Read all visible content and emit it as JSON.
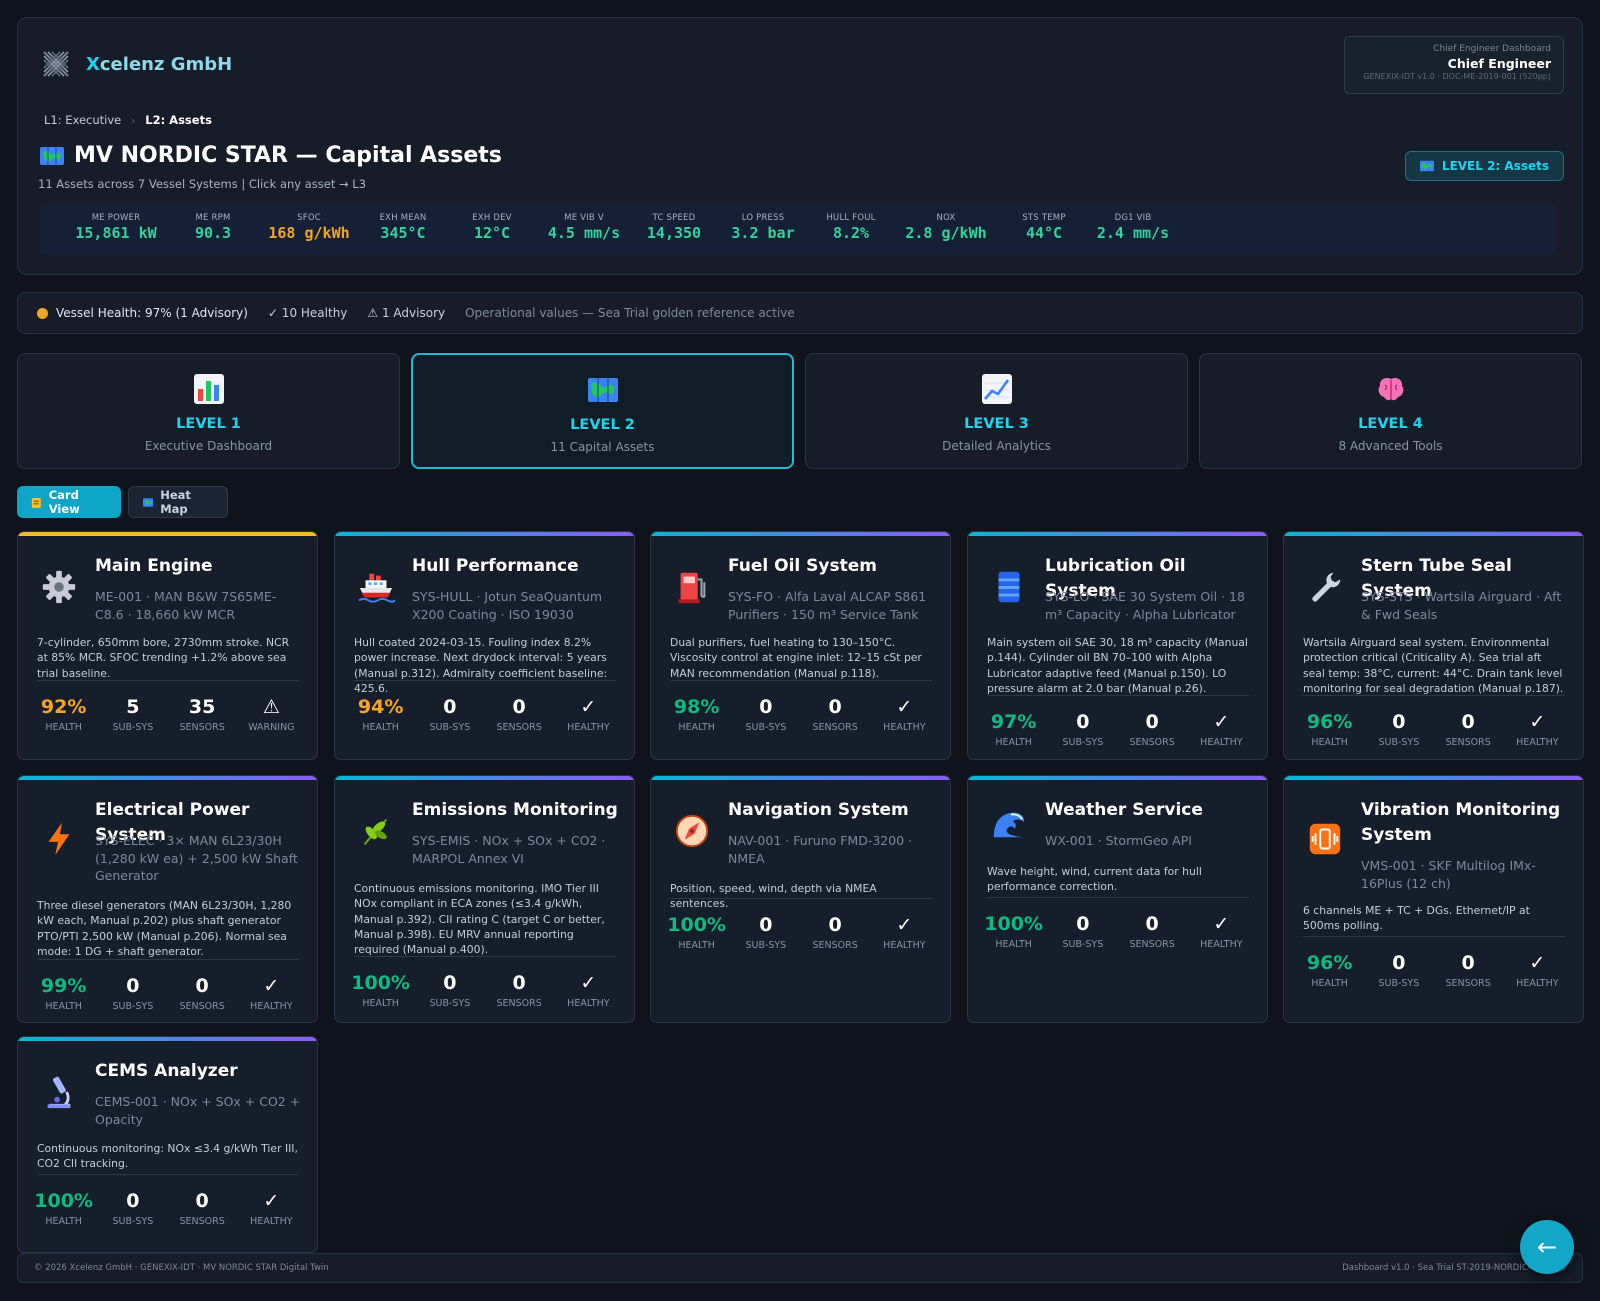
{
  "header": {
    "brand": "Xcelenz GmbH",
    "brand_x": "X",
    "brand_rest": "celenz GmbH",
    "role_sub": "Chief Engineer Dashboard",
    "role_name": "Chief Engineer",
    "role_doc": "GENEXIX-IDT v1.0 · DOC-ME-2019-001 (520pp)",
    "breadcrumb": [
      "L1: Executive",
      "L2: Assets"
    ],
    "title": "MV NORDIC STAR — Capital Assets",
    "subtitle": "11 Assets across 7 Vessel Systems | Click any asset → L3",
    "level_badge": "LEVEL 2: Assets"
  },
  "kpis": [
    {
      "label": "ME POWER",
      "value": "15,861 kW",
      "color": "#34d399"
    },
    {
      "label": "ME RPM",
      "value": "90.3",
      "color": "#34d399"
    },
    {
      "label": "SFOC",
      "value": "168 g/kWh",
      "color": "#f5a524"
    },
    {
      "label": "EXH MEAN",
      "value": "345°C",
      "color": "#34d399"
    },
    {
      "label": "EXH DEV",
      "value": "12°C",
      "color": "#34d399"
    },
    {
      "label": "ME VIB V",
      "value": "4.5 mm/s",
      "color": "#34d399"
    },
    {
      "label": "TC SPEED",
      "value": "14,350",
      "color": "#34d399"
    },
    {
      "label": "LO PRESS",
      "value": "3.2 bar",
      "color": "#34d399"
    },
    {
      "label": "HULL FOUL",
      "value": "8.2%",
      "color": "#34d399"
    },
    {
      "label": "NOX",
      "value": "2.8 g/kWh",
      "color": "#34d399"
    },
    {
      "label": "STS TEMP",
      "value": "44°C",
      "color": "#34d399"
    },
    {
      "label": "DG1 VIB",
      "value": "2.4 mm/s",
      "color": "#34d399"
    }
  ],
  "status": {
    "health": "Vessel Health: 97% (1 Advisory)",
    "healthy": "✓ 10 Healthy",
    "advisory": "⚠ 1 Advisory",
    "note": "Operational values — Sea Trial golden reference active"
  },
  "levels": [
    {
      "label": "LEVEL 1",
      "desc": "Executive Dashboard",
      "icon": "bar-chart-icon"
    },
    {
      "label": "LEVEL 2",
      "desc": "11 Capital Assets",
      "icon": "map-icon"
    },
    {
      "label": "LEVEL 3",
      "desc": "Detailed Analytics",
      "icon": "line-chart-icon"
    },
    {
      "label": "LEVEL 4",
      "desc": "8 Advanced Tools",
      "icon": "brain-icon"
    }
  ],
  "views": {
    "card": "Card View",
    "heat": "Heat Map"
  },
  "stat_labels": {
    "health": "HEALTH",
    "subsys": "SUB-SYS",
    "sensors": "SENSORS"
  },
  "assets": [
    {
      "name": "Main Engine",
      "meta": "ME-001 · MAN B&W 7S65ME-C8.6 · 18,660 kW MCR",
      "desc": "7-cylinder, 650mm bore, 2730mm stroke. NCR at 85% MCR. SFOC trending +1.2% above sea trial baseline.",
      "health": "92%",
      "subsys": "5",
      "sensors": "35",
      "state_symbol": "⚠",
      "state": "WARNING",
      "icon": "gear-icon"
    },
    {
      "name": "Hull Performance",
      "meta": "SYS-HULL · Jotun SeaQuantum X200 Coating · ISO 19030",
      "desc": "Hull coated 2024-03-15. Fouling index 8.2% power increase. Next drydock interval: 5 years (Manual p.312). Admiralty coefficient baseline: 425.6.",
      "health": "94%",
      "subsys": "0",
      "sensors": "0",
      "state_symbol": "✓",
      "state": "HEALTHY",
      "icon": "ship-icon"
    },
    {
      "name": "Fuel Oil System",
      "meta": "SYS-FO · Alfa Laval ALCAP S861 Purifiers · 150 m³ Service Tank",
      "desc": "Dual purifiers, fuel heating to 130–150°C. Viscosity control at engine inlet: 12–15 cSt per MAN recommendation (Manual p.118).",
      "health": "98%",
      "subsys": "0",
      "sensors": "0",
      "state_symbol": "✓",
      "state": "HEALTHY",
      "icon": "fuel-pump-icon"
    },
    {
      "name": "Lubrication Oil System",
      "meta": "SYS-LO · SAE 30 System Oil · 18 m³ Capacity · Alpha Lubricator",
      "desc": "Main system oil SAE 30, 18 m³ capacity (Manual p.144). Cylinder oil BN 70–100 with Alpha Lubricator adaptive feed (Manual p.150). LO pressure alarm at 2.0 bar (Manual p.26).",
      "health": "97%",
      "subsys": "0",
      "sensors": "0",
      "state_symbol": "✓",
      "state": "HEALTHY",
      "icon": "oil-drum-icon"
    },
    {
      "name": "Stern Tube Seal System",
      "meta": "SYS-STS · Wartsila Airguard · Aft & Fwd Seals",
      "desc": "Wartsila Airguard seal system. Environmental protection critical (Criticality A). Sea trial aft seal temp: 38°C, current: 44°C. Drain tank level monitoring for seal degradation (Manual p.187).",
      "health": "96%",
      "subsys": "0",
      "sensors": "0",
      "state_symbol": "✓",
      "state": "HEALTHY",
      "icon": "wrench-icon"
    },
    {
      "name": "Electrical Power System",
      "meta": "SYS-ELEC · 3× MAN 6L23/30H (1,280 kW ea) + 2,500 kW Shaft Generator",
      "desc": "Three diesel generators (MAN 6L23/30H, 1,280 kW each, Manual p.202) plus shaft generator PTO/PTI 2,500 kW (Manual p.206). Normal sea mode: 1 DG + shaft generator.",
      "health": "99%",
      "subsys": "0",
      "sensors": "0",
      "state_symbol": "✓",
      "state": "HEALTHY",
      "icon": "lightning-icon"
    },
    {
      "name": "Emissions Monitoring",
      "meta": "SYS-EMIS · NOx + SOx + CO2 · MARPOL Annex VI",
      "desc": "Continuous emissions monitoring. IMO Tier III NOx compliant in ECA zones (≤3.4 g/kWh, Manual p.392). CII rating C (target C or better, Manual p.398). EU MRV annual reporting required (Manual p.400).",
      "health": "100%",
      "subsys": "0",
      "sensors": "0",
      "state_symbol": "✓",
      "state": "HEALTHY",
      "icon": "leaf-icon"
    },
    {
      "name": "Navigation System",
      "meta": "NAV-001 · Furuno FMD-3200 · NMEA",
      "desc": "Position, speed, wind, depth via NMEA sentences.",
      "health": "100%",
      "subsys": "0",
      "sensors": "0",
      "state_symbol": "✓",
      "state": "HEALTHY",
      "icon": "compass-icon"
    },
    {
      "name": "Weather Service",
      "meta": "WX-001 · StormGeo API",
      "desc": "Wave height, wind, current data for hull performance correction.",
      "health": "100%",
      "subsys": "0",
      "sensors": "0",
      "state_symbol": "✓",
      "state": "HEALTHY",
      "icon": "wave-icon"
    },
    {
      "name": "Vibration Monitoring System",
      "meta": "VMS-001 · SKF Multilog IMx-16Plus (12 ch)",
      "desc": "6 channels ME + TC + DGs. Ethernet/IP at 500ms polling.",
      "health": "96%",
      "subsys": "0",
      "sensors": "0",
      "state_symbol": "✓",
      "state": "HEALTHY",
      "icon": "vibration-icon"
    },
    {
      "name": "CEMS Analyzer",
      "meta": "CEMS-001 · NOx + SOx + CO2 + Opacity",
      "desc": "Continuous monitoring: NOx ≤3.4 g/kWh Tier III, CO2 CII tracking.",
      "health": "100%",
      "subsys": "0",
      "sensors": "0",
      "state_symbol": "✓",
      "state": "HEALTHY",
      "icon": "microscope-icon"
    }
  ],
  "footer": {
    "left": "© 2026 Xcelenz GmbH · GENEXIX-IDT · MV NORDIC STAR Digital Twin",
    "right": "Dashboard v1.0 · Sea Trial ST-2019-NORDIC-001 · 20"
  },
  "fab": "←"
}
